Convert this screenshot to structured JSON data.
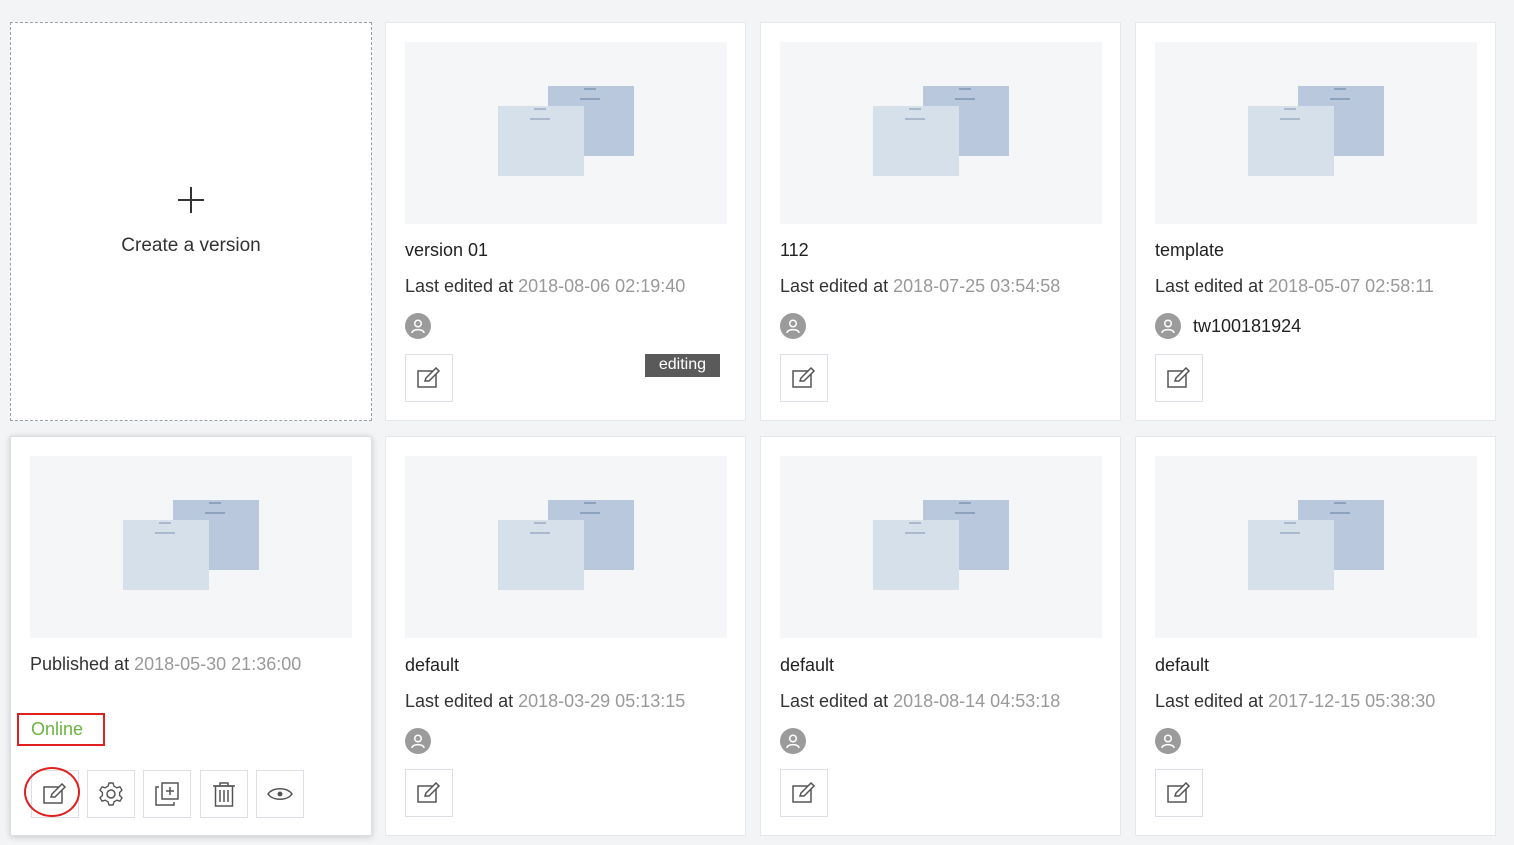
{
  "create_card": {
    "label": "Create a version"
  },
  "published_card": {
    "published_label": "Published at",
    "published_at": "2018-05-30 21:36:00",
    "status": "Online",
    "actions": [
      "edit-icon",
      "gear-icon",
      "duplicate-icon",
      "trash-icon",
      "eye-icon"
    ]
  },
  "edited_label": "Last edited at",
  "versions": [
    {
      "title": "version 01",
      "edited_at": "2018-08-06 02:19:40",
      "user": "",
      "badge": "editing"
    },
    {
      "title": "112",
      "edited_at": "2018-07-25 03:54:58",
      "user": "",
      "badge": ""
    },
    {
      "title": "template",
      "edited_at": "2018-05-07 02:58:11",
      "user": "tw100181924",
      "badge": ""
    },
    {
      "title": "default",
      "edited_at": "2018-03-29 05:13:15",
      "user": "",
      "badge": ""
    },
    {
      "title": "default",
      "edited_at": "2018-08-14 04:53:18",
      "user": "",
      "badge": ""
    },
    {
      "title": "default",
      "edited_at": "2017-12-15 05:38:30",
      "user": "",
      "badge": ""
    }
  ],
  "colors": {
    "online": "#6ab43c",
    "highlight": "#e02020",
    "badge_bg": "#5a5a5a"
  }
}
